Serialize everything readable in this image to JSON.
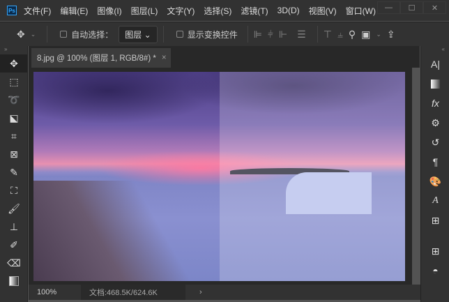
{
  "app": {
    "logo": "Ps"
  },
  "menu": [
    "文件(F)",
    "编辑(E)",
    "图像(I)",
    "图层(L)",
    "文字(Y)",
    "选择(S)",
    "滤镜(T)",
    "3D(D)",
    "视图(V)",
    "窗口(W)"
  ],
  "window_controls": {
    "minimize": "—",
    "maximize": "☐",
    "close": "✕"
  },
  "options": {
    "auto_select_label": "自动选择：",
    "auto_select_value": "图层",
    "show_transform_label": "显示变换控件"
  },
  "tab": {
    "title": "8.jpg @ 100% (图层 1, RGB/8#) *",
    "close": "×"
  },
  "status": {
    "zoom": "100%",
    "doc": "文档:468.5K/624.6K",
    "arrow": "›"
  },
  "tools": [
    "move",
    "marquee",
    "lasso",
    "object-select",
    "crop",
    "frame",
    "eyedropper",
    "healing",
    "brush",
    "stamp",
    "history-brush",
    "eraser",
    "gradient"
  ],
  "right_panel": [
    "character",
    "gradients",
    "fx",
    "adjustments",
    "history",
    "paragraph",
    "swatches",
    "glyphs",
    "libraries",
    "layers"
  ]
}
